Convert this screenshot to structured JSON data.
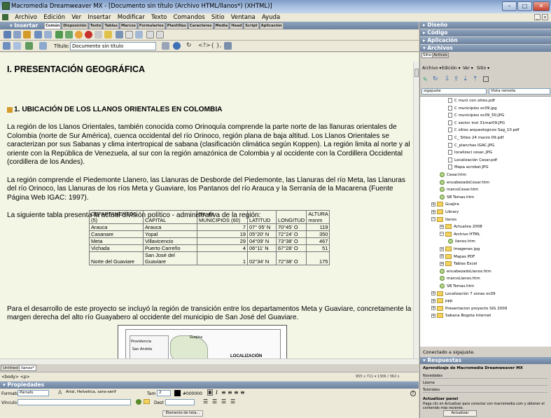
{
  "window": {
    "title": "Macromedia Dreamweaver MX - [Documento sin título (Archivo HTML/llanos*) (XHTML)]"
  },
  "menu": [
    "Archivo",
    "Edición",
    "Ver",
    "Insertar",
    "Modificar",
    "Texto",
    "Comandos",
    "Sitio",
    "Ventana",
    "Ayuda"
  ],
  "insert_bar": {
    "label": "▾ Insertar",
    "tabs": [
      "Común",
      "Disposición",
      "Texto",
      "Tablas",
      "Marcos",
      "Formularios",
      "Plantillas",
      "Caracteres",
      "Media",
      "Head",
      "Script",
      "Aplicación"
    ]
  },
  "doc_toolbar": {
    "title_label": "Título:",
    "title_value": "Documento sin título"
  },
  "document": {
    "heading": "I. PRESENTACIÓN GEOGRÁFICA",
    "subheading": "1. UBICACIÓN DE LOS LLANOS ORIENTALES EN COLOMBIA",
    "p1": "La región de los Llanos Orientales, también conocida como Orinoquía comprende la parte norte de las llanuras orientales de Colombia (norte de Sur América), cuenca occidental del río Orinoco, región plana de baja altitud. Los Llanos Orientales se caracterizan por sus Sabanas y clima intertropical de sabana (clasificación climática según Koppen). La región limita al norte y al oriente con la República de Venezuela, al sur con la región amazónica de Colombia y al occidente con la Cordillera Occidental (cordillera de los Andes).",
    "p2": "La región comprende el Piedemonte Llanero, las Llanuras de Desborde del Piedemonte, las Llanuras del río Meta, las Llanuras del río Orinoco, las Llanuras de los ríos Meta y Guaviare, los Pantanos del río Arauca y la Serranía de la Macarena (Fuente Página Web IGAC: 1997).",
    "p3": "La siguiente tabla presenta la actual división político - administrativa de la región:",
    "p4": "Para el desarrollo de este proyecto se incluyó la región de transición entre los departamentos Meta y Guaviare, concretamente la margen derecha del alto río Guayabero al occidente del municipio de San José del Guaviare.",
    "table": {
      "headers": [
        "DEPARTAMENTOS (5)",
        "CAPITAL",
        "No. de MUNICIPIOS (60)",
        "LATITUD",
        "LONGITUD",
        "ALTURA msnm"
      ],
      "rows": [
        [
          "Arauca",
          "Arauca",
          "7",
          "07° 05' N",
          "70°45' O",
          "119"
        ],
        [
          "Casanare",
          "Yopal",
          "19",
          "05°20' N",
          "72°24' O",
          "350"
        ],
        [
          "Meta",
          "Villavicencio",
          "29",
          "04°09' N",
          "73°38' O",
          "467"
        ],
        [
          "Vichada",
          "Puerto Carreño",
          "4",
          "06°11' N",
          "67°28' O",
          "51"
        ],
        [
          "Norte del Guaviare",
          "San José del Guaviare",
          "1",
          "02°34' N",
          "72°38' O",
          "175"
        ]
      ]
    },
    "map": {
      "label1": "LOCALIZACIÓN",
      "place1": "Providencia",
      "place2": "San Andrés",
      "place3": "Guajira"
    }
  },
  "doc_tabs": [
    "Untitled-1",
    "llanos*"
  ],
  "status": {
    "tags": "<body> <p>",
    "info": "955 x 711 ▾  130K / 362 s"
  },
  "properties": {
    "header": "▾ Propiedades",
    "formato_label": "Formato",
    "formato_value": "Párrafo",
    "fuente_value": "Arial, Helvetica, sans-serif",
    "tam_label": "Tam",
    "tam_value": "2",
    "color_value": "#000000",
    "vinculo_label": "Vínculo",
    "dest_label": "Dest",
    "list_btn": "Elemento de lista..."
  },
  "right": {
    "p_diseno": "▸ Diseño",
    "p_codigo": "▸ Código",
    "p_aplicacion": "▸ Aplicación",
    "p_archivos": "▾ Archivos",
    "tabs": [
      "Sitio",
      "Activos"
    ],
    "menu": [
      "Archivo ▾",
      "Edición ▾",
      "Ver ▾",
      "Sitio ▾"
    ],
    "site_value": "sigajuste",
    "view_value": "Vista remota",
    "status": "Conectado a sigajuste.",
    "respuestas": "▾ Respuestas",
    "resp_title": "Aprendizaje de Macromedia Dreamweaver MX",
    "resp_links": [
      "Novedades",
      "Léame",
      "Tutoriales"
    ],
    "update_title": "Actualizar panel",
    "update_text": "Haga clic en Actualizar para conectar con macromedia.com y obtener el contenido más reciente.",
    "update_btn": "Actualizar"
  },
  "tree": [
    {
      "t": "C muni con sitios.pdf",
      "k": "f",
      "l": 3
    },
    {
      "t": "C municipios oc09.jpg",
      "k": "f",
      "l": 3
    },
    {
      "t": "C municipios oc09_50.JPG",
      "k": "f",
      "l": 3
    },
    {
      "t": "C sector inst 31mar09.JPG",
      "k": "f",
      "l": 3
    },
    {
      "t": "C sitios arqueologicos Sag_10.pdf",
      "k": "f",
      "l": 3
    },
    {
      "t": "C_ Sitios 24 marzo 09.pdf",
      "k": "f",
      "l": 3
    },
    {
      "t": "C_planchas IGAC.JPG",
      "k": "f",
      "l": 3
    },
    {
      "t": "localizaci cesar..JPG",
      "k": "f",
      "l": 3
    },
    {
      "t": "Localización Cesar.pdf",
      "k": "f",
      "l": 3
    },
    {
      "t": "Mapa acrobat.JPG",
      "k": "f",
      "l": 3
    },
    {
      "t": "Cesar.htm",
      "k": "h",
      "l": 2
    },
    {
      "t": "encabezadoCesar.htm",
      "k": "h",
      "l": 2
    },
    {
      "t": "marcoCesar.htm",
      "k": "h",
      "l": 2
    },
    {
      "t": "SB Temas.htm",
      "k": "h",
      "l": 2
    },
    {
      "t": "Guajira",
      "k": "d",
      "l": 1,
      "e": "+"
    },
    {
      "t": "Library",
      "k": "d",
      "l": 1,
      "e": "+"
    },
    {
      "t": "llanos",
      "k": "d",
      "l": 1,
      "e": "−"
    },
    {
      "t": "Actualiza 2008",
      "k": "d",
      "l": 2,
      "e": "+"
    },
    {
      "t": "Archivo HTML",
      "k": "d",
      "l": 2,
      "e": "−"
    },
    {
      "t": "llanos.htm",
      "k": "h",
      "l": 3
    },
    {
      "t": "Imagenes jpg",
      "k": "d",
      "l": 2,
      "e": "+"
    },
    {
      "t": "Mapas PDF",
      "k": "d",
      "l": 2,
      "e": "+"
    },
    {
      "t": "Tablas Excel",
      "k": "d",
      "l": 2,
      "e": "+"
    },
    {
      "t": "encabezadoLlanos.htm",
      "k": "h",
      "l": 2
    },
    {
      "t": "marcoLlanos.htm",
      "k": "h",
      "l": 2
    },
    {
      "t": "SB Temas.htm",
      "k": "h",
      "l": 2
    },
    {
      "t": "Localización 7 zonas oc09",
      "k": "d",
      "l": 1,
      "e": "+"
    },
    {
      "t": "ppp",
      "k": "d",
      "l": 1,
      "e": "+"
    },
    {
      "t": "Presentacion proyecto SIG 2009",
      "k": "d",
      "l": 1,
      "e": "+"
    },
    {
      "t": "Sabana Bogota Internet",
      "k": "d",
      "l": 1,
      "e": "+"
    }
  ],
  "colors": {
    "panel_header": "#7a8fab",
    "doc_bg": "#f3f5e5",
    "title_bar": "#a8c0e0"
  }
}
